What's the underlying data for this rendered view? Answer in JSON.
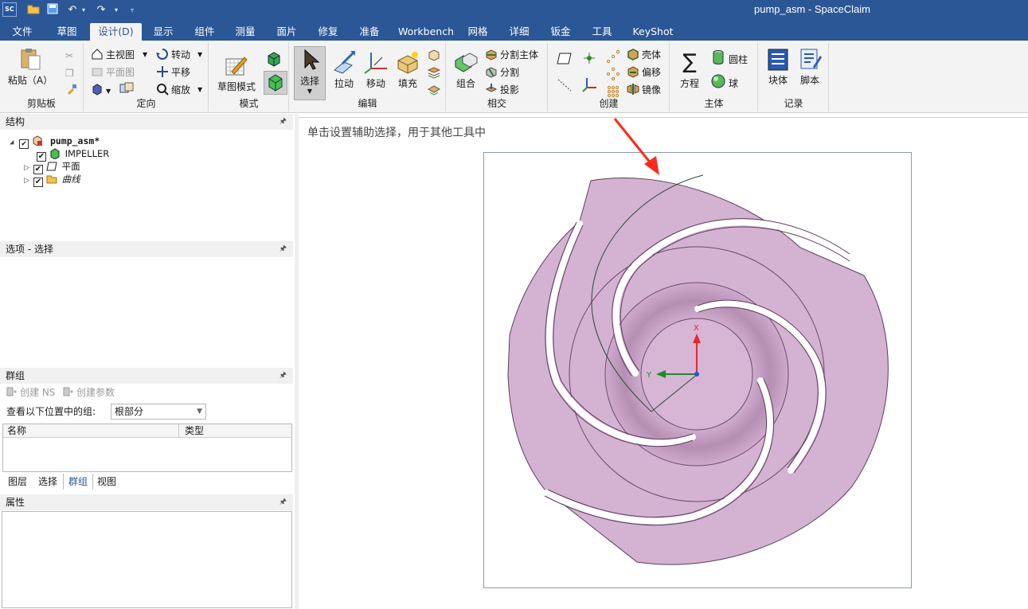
{
  "window": {
    "app_icon": "SC",
    "title": "pump_asm - SpaceClaim",
    "quick_access": [
      "open-folder-icon",
      "save-icon",
      "undo-icon",
      "redo-icon",
      "customize-icon"
    ]
  },
  "tabs": [
    {
      "label": "文件"
    },
    {
      "label": "草图"
    },
    {
      "label": "设计(D)"
    },
    {
      "label": "显示"
    },
    {
      "label": "组件"
    },
    {
      "label": "测量"
    },
    {
      "label": "面片"
    },
    {
      "label": "修复"
    },
    {
      "label": "准备"
    },
    {
      "label": "Workbench"
    },
    {
      "label": "网格"
    },
    {
      "label": "详细"
    },
    {
      "label": "钣金"
    },
    {
      "label": "工具"
    },
    {
      "label": "KeyShot"
    }
  ],
  "active_tab": "设计(D)",
  "ribbon": {
    "clipboard": {
      "label": "剪贴板",
      "paste": "粘贴（A）"
    },
    "orient": {
      "label": "定向",
      "home": "主视图",
      "plan": "平面图",
      "spin": "转动",
      "pan": "平移",
      "zoom": "缩放"
    },
    "mode": {
      "label": "模式",
      "sketch_mode": "草图模式"
    },
    "edit": {
      "label": "编辑",
      "select": "选择",
      "pull": "拉动",
      "move": "移动",
      "fill": "填充"
    },
    "intersect": {
      "label": "相交",
      "combine": "组合",
      "split_body": "分割主体",
      "split": "分割",
      "project": "投影"
    },
    "create": {
      "label": "创建",
      "shell": "壳体",
      "offset": "偏移",
      "mirror": "镜像"
    },
    "body": {
      "label": "主体",
      "equation": "方程",
      "cylinder": "圆柱",
      "sphere": "球"
    },
    "record": {
      "label": "记录",
      "block": "块体",
      "script": "脚本"
    }
  },
  "structure": {
    "title": "结构",
    "tree": [
      {
        "label": "pump_asm*",
        "checked": true,
        "expanded": true,
        "icon": "assembly-icon"
      },
      {
        "label": "IMPELLER",
        "checked": true,
        "icon": "solid-body-icon"
      },
      {
        "label": "平面",
        "checked": true,
        "icon": "plane-icon"
      },
      {
        "label": "曲线",
        "checked": true,
        "icon": "curves-folder-icon"
      }
    ]
  },
  "options": {
    "title": "选项 - 选择"
  },
  "groups": {
    "title": "群组",
    "create_ns": "创建 NS",
    "create_param": "创建参数",
    "view_label": "查看以下位置中的组:",
    "view_value": "根部分",
    "columns": [
      "名称",
      "类型"
    ]
  },
  "bottom_tabs": [
    {
      "label": "图层"
    },
    {
      "label": "选择"
    },
    {
      "label": "群组"
    },
    {
      "label": "视图"
    }
  ],
  "active_bottom_tab": "群组",
  "properties": {
    "title": "属性"
  },
  "viewport": {
    "hint": "单击设置辅助选择，用于其他工具中",
    "axes": {
      "x": "X",
      "y": "Y"
    },
    "colors": {
      "impeller_fill": "#d4b2d2",
      "impeller_edge": "#5a3f5a",
      "curve": "#2a4a35",
      "arrow": "#ff2a1a",
      "x_axis": "#e8262c",
      "y_axis": "#1d8a2a",
      "origin": "#2a55c8"
    }
  }
}
